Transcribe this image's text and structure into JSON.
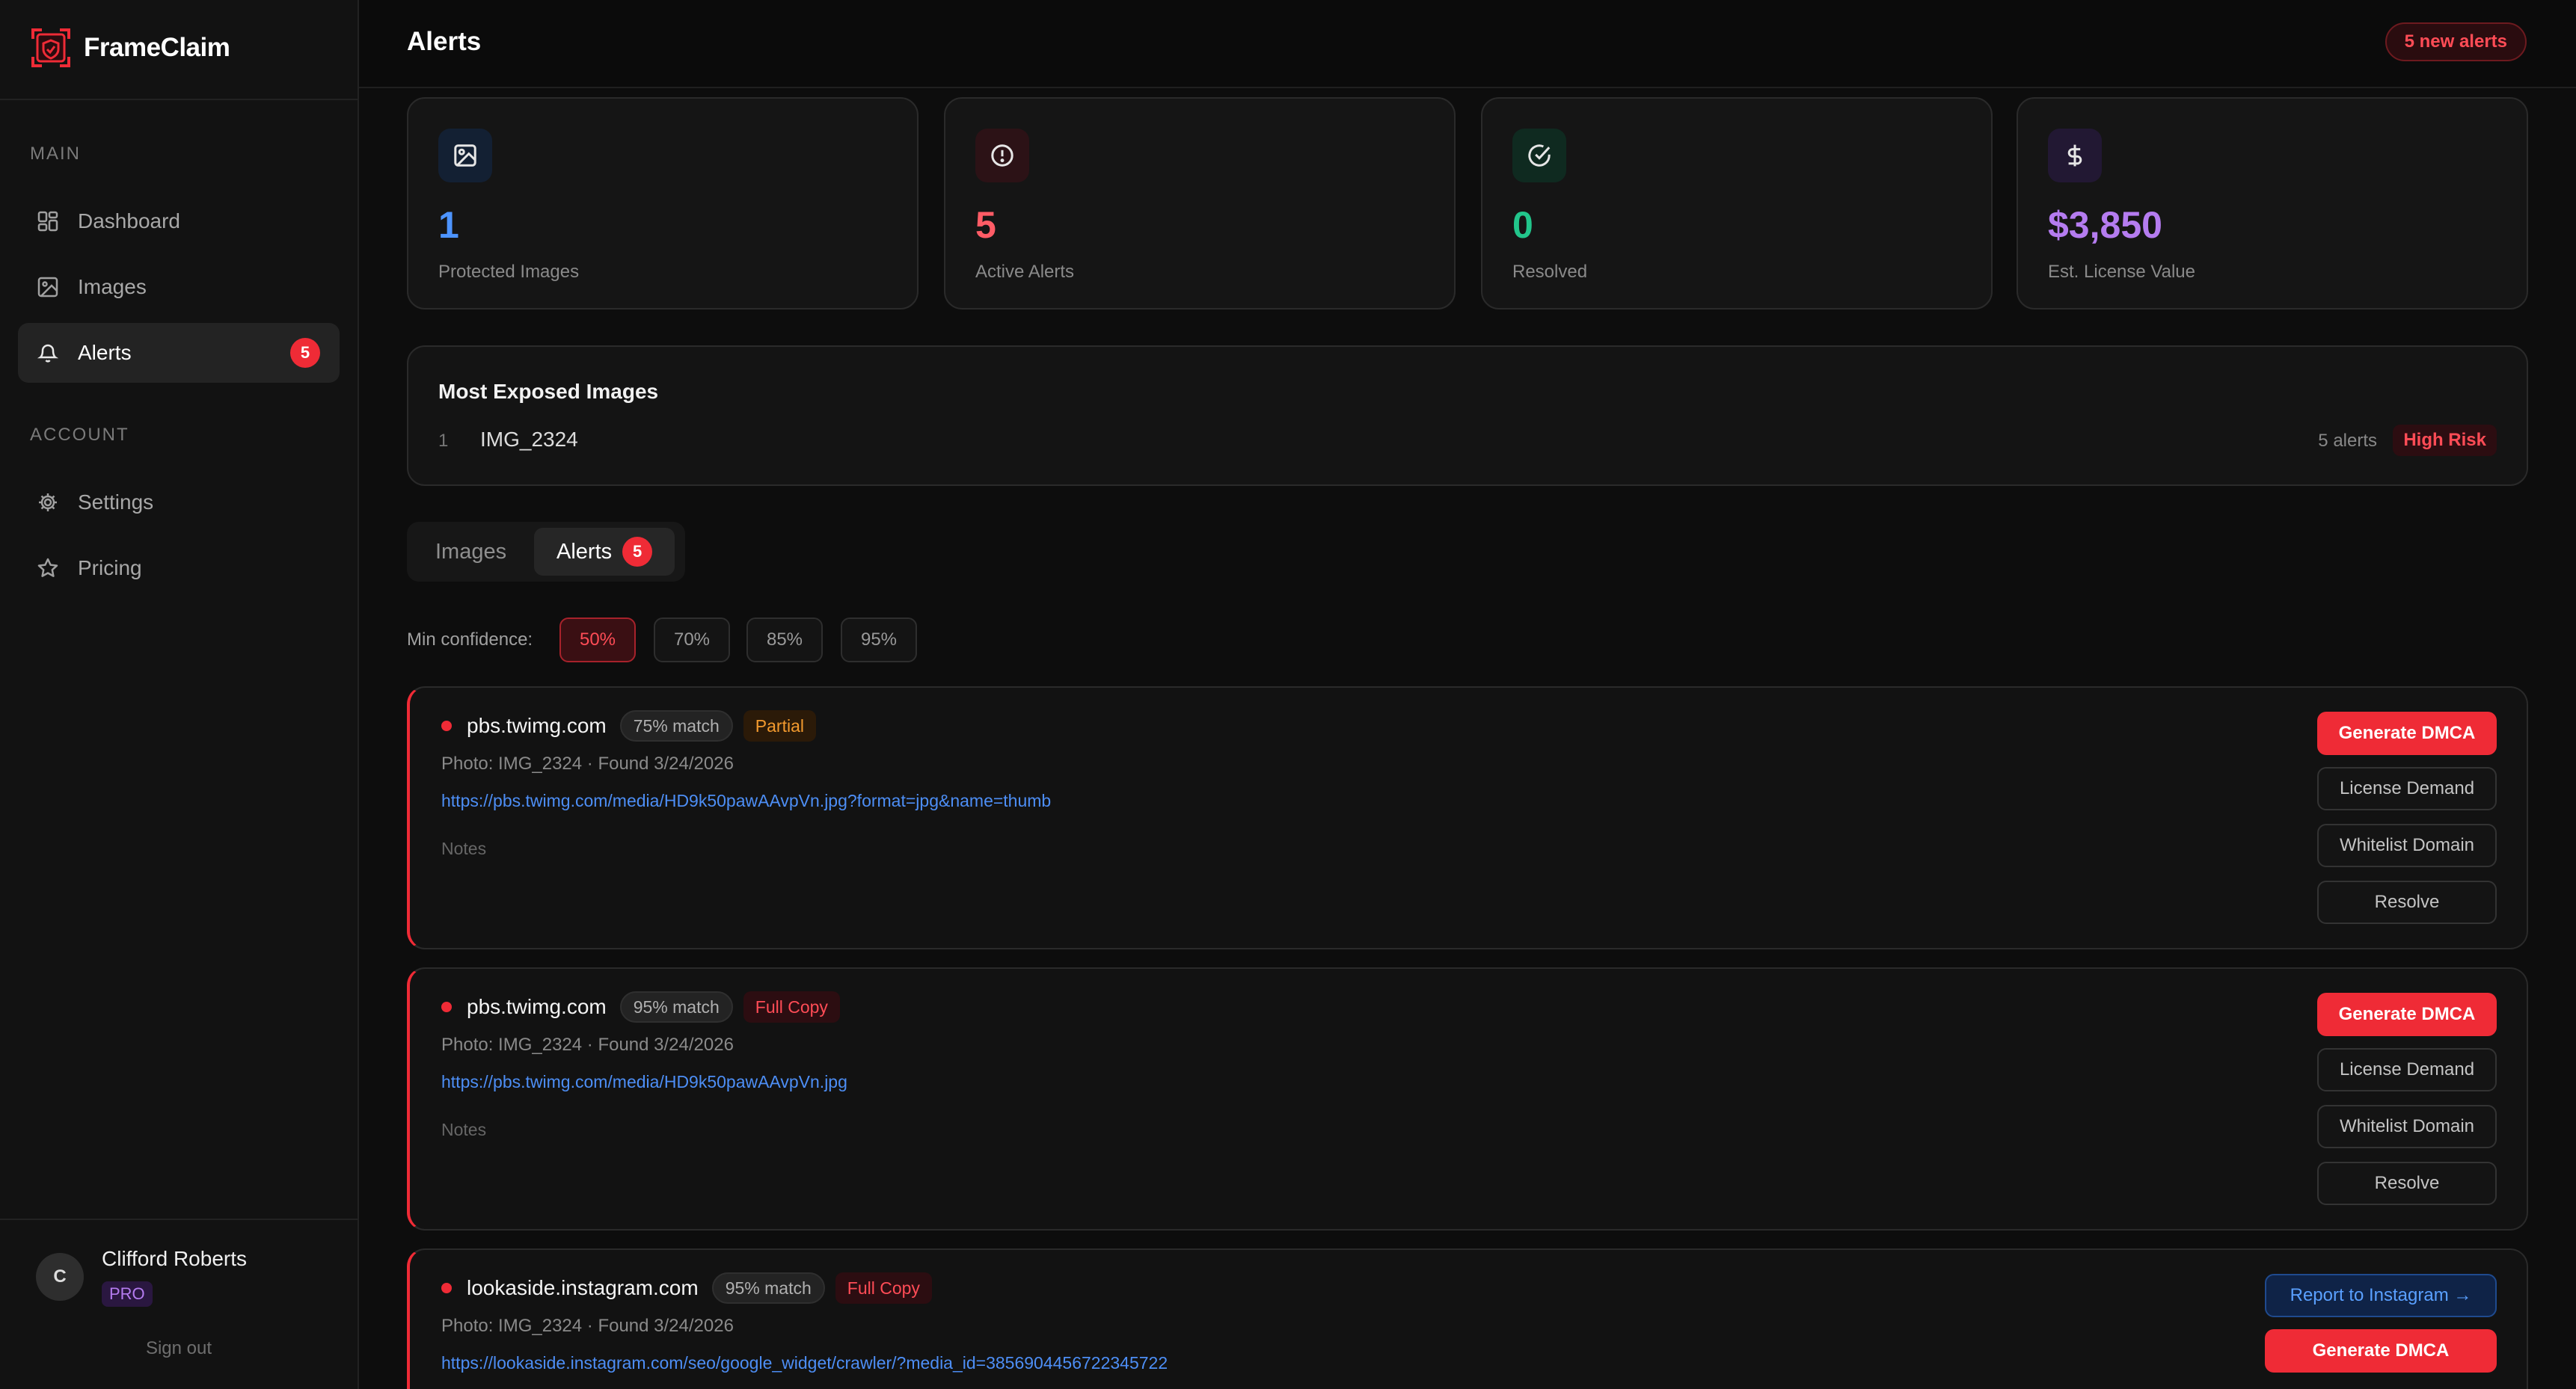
{
  "app": {
    "name": "FrameClaim"
  },
  "sidebar": {
    "sections": {
      "main": "MAIN",
      "account": "ACCOUNT"
    },
    "items": [
      {
        "label": "Dashboard",
        "icon": "dashboard-icon"
      },
      {
        "label": "Images",
        "icon": "image-icon"
      },
      {
        "label": "Alerts",
        "icon": "bell-icon",
        "badge": "5",
        "active": true
      },
      {
        "label": "Settings",
        "icon": "gear-icon"
      },
      {
        "label": "Pricing",
        "icon": "star-icon"
      }
    ],
    "user": {
      "initial": "C",
      "name": "Clifford Roberts",
      "plan": "PRO"
    },
    "signout": "Sign out"
  },
  "header": {
    "title": "Alerts",
    "new_alerts": "5 new alerts"
  },
  "stats": [
    {
      "value": "1",
      "label": "Protected Images",
      "icon": "image-icon",
      "color": "#4d94ff"
    },
    {
      "value": "5",
      "label": "Active Alerts",
      "icon": "alert-circle-icon",
      "color": "#ff5c66"
    },
    {
      "value": "0",
      "label": "Resolved",
      "icon": "check-circle-icon",
      "color": "#22c58b"
    },
    {
      "value": "$3,850",
      "label": "Est. License Value",
      "icon": "dollar-icon",
      "color": "#b57cf0"
    }
  ],
  "exposed": {
    "title": "Most Exposed Images",
    "rows": [
      {
        "rank": "1",
        "name": "IMG_2324",
        "count": "5 alerts",
        "risk": "High Risk"
      }
    ]
  },
  "tabs": [
    {
      "label": "Images"
    },
    {
      "label": "Alerts",
      "badge": "5",
      "active": true
    }
  ],
  "filter": {
    "label": "Min confidence:",
    "options": [
      "50%",
      "70%",
      "85%",
      "95%"
    ],
    "selected": "50%"
  },
  "alerts": [
    {
      "domain": "pbs.twimg.com",
      "match": "75% match",
      "type": "Partial",
      "meta": "Photo: IMG_2324 · Found 3/24/2026",
      "url": "https://pbs.twimg.com/media/HD9k50pawAAvpVn.jpg?format=jpg&name=thumb",
      "notes": "Notes",
      "actions": [
        "Generate DMCA",
        "License Demand",
        "Whitelist Domain",
        "Resolve"
      ]
    },
    {
      "domain": "pbs.twimg.com",
      "match": "95% match",
      "type": "Full Copy",
      "meta": "Photo: IMG_2324 · Found 3/24/2026",
      "url": "https://pbs.twimg.com/media/HD9k50pawAAvpVn.jpg",
      "notes": "Notes",
      "actions": [
        "Generate DMCA",
        "License Demand",
        "Whitelist Domain",
        "Resolve"
      ]
    },
    {
      "domain": "lookaside.instagram.com",
      "match": "95% match",
      "type": "Full Copy",
      "meta": "Photo: IMG_2324 · Found 3/24/2026",
      "url": "https://lookaside.instagram.com/seo/google_widget/crawler/?media_id=3856904456722345722",
      "actions": [
        "Report to Instagram →",
        "Generate DMCA"
      ]
    }
  ]
}
